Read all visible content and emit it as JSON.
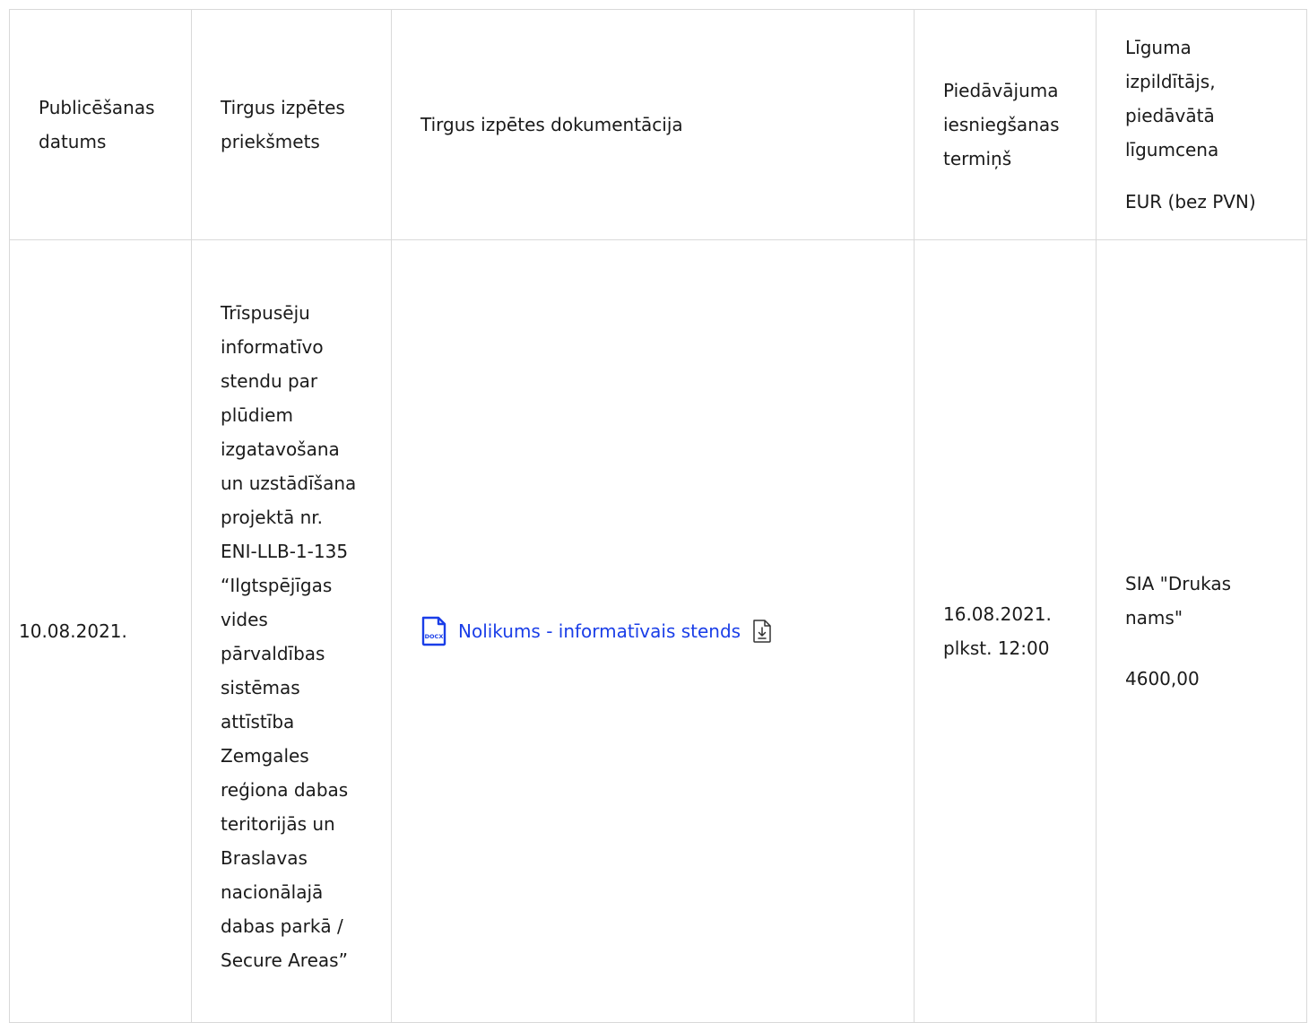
{
  "table": {
    "headers": {
      "date": "Publicēšanas datums",
      "subject": "Tirgus izpētes priekšmets",
      "documentation": "Tirgus izpētes dokumentācija",
      "deadline": "Piedāvājuma iesniegšanas termiņš",
      "contractor": "Līguma izpildītājs, piedāvātā līgumcena",
      "contractor_unit": "EUR (bez PVN)"
    },
    "row": {
      "date": "10.08.2021.",
      "subject": "Trīspusēju informatīvo stendu par plūdiem izgatavošana un uzstādīšana projektā nr. ENI-LLB-1-135 “Ilgtspējīgas vides pārvaldības sistēmas attīstība Zemgales reģiona dabas teritorijās un Braslavas nacionālajā dabas parkā / Secure Areas”",
      "doc_link": "Nolikums - informatīvais stends",
      "doc_icon": "docx-file-icon",
      "doc_icon_label": "DOCX",
      "download_icon": "download-icon",
      "deadline_date": "16.08.2021.",
      "deadline_time": "plkst. 12:00",
      "contractor_name": "SIA \"Drukas nams\"",
      "contract_price": "4600,00"
    }
  },
  "colors": {
    "link": "#1a3ee8",
    "border": "#d9d9d9",
    "text": "#1a1a1a"
  }
}
